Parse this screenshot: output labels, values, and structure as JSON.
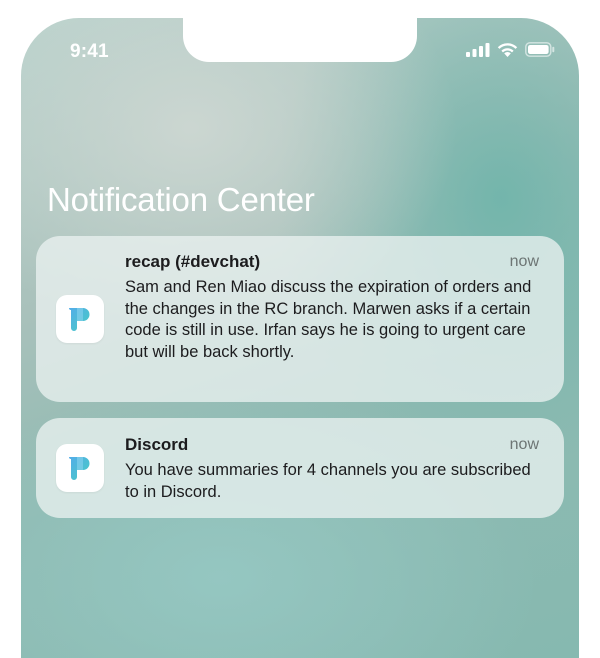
{
  "status_bar": {
    "time": "9:41",
    "icons": [
      "cellular-signal-icon",
      "wifi-icon",
      "battery-icon"
    ]
  },
  "screen": {
    "title": "Notification Center"
  },
  "notifications": [
    {
      "app_icon": "recap-app-icon",
      "title": "recap (#devchat)",
      "time": "now",
      "body": "Sam and Ren Miao discuss the expiration of orders and the changes in the RC branch. Marwen asks if a certain code is still in use. Irfan says he is going to urgent care but will be back shortly."
    },
    {
      "app_icon": "recap-app-icon",
      "title": "Discord",
      "time": "now",
      "body": "You have summaries for 4 channels you are subscribed to in Discord."
    }
  ],
  "colors": {
    "card_background": "#e9f1ef",
    "text_primary": "#1c1c1e",
    "text_secondary": "#6d7574",
    "app_icon_gradient": [
      "#4aa8e8",
      "#3ec9c0"
    ]
  }
}
